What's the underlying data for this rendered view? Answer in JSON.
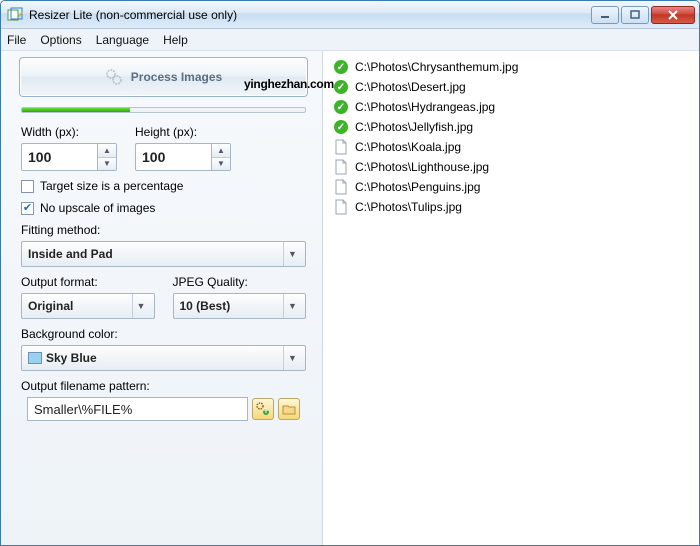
{
  "window": {
    "title": "Resizer Lite (non-commercial use only)"
  },
  "menu": {
    "file": "File",
    "options": "Options",
    "language": "Language",
    "help": "Help"
  },
  "process": {
    "label": "Process Images"
  },
  "progress": {
    "percent": 38
  },
  "dims": {
    "width_label": "Width (px):",
    "width": "100",
    "height_label": "Height (px):",
    "height": "100"
  },
  "opts": {
    "percent_label": "Target size is a percentage",
    "percent_checked": false,
    "noupscale_label": "No upscale of images",
    "noupscale_checked": true
  },
  "fit": {
    "label": "Fitting method:",
    "value": "Inside and Pad"
  },
  "out": {
    "fmt_label": "Output format:",
    "fmt": "Original",
    "q_label": "JPEG Quality:",
    "q": "10 (Best)"
  },
  "bg": {
    "label": "Background color:",
    "value": "Sky Blue"
  },
  "pattern": {
    "label": "Output filename pattern:",
    "value": "Smaller\\%FILE%"
  },
  "watermark": "yinghezhan.com",
  "files": [
    {
      "status": "done",
      "path": "C:\\Photos\\Chrysanthemum.jpg"
    },
    {
      "status": "done",
      "path": "C:\\Photos\\Desert.jpg"
    },
    {
      "status": "done",
      "path": "C:\\Photos\\Hydrangeas.jpg"
    },
    {
      "status": "done",
      "path": "C:\\Photos\\Jellyfish.jpg"
    },
    {
      "status": "file",
      "path": "C:\\Photos\\Koala.jpg"
    },
    {
      "status": "file",
      "path": "C:\\Photos\\Lighthouse.jpg"
    },
    {
      "status": "file",
      "path": "C:\\Photos\\Penguins.jpg"
    },
    {
      "status": "file",
      "path": "C:\\Photos\\Tulips.jpg"
    }
  ]
}
